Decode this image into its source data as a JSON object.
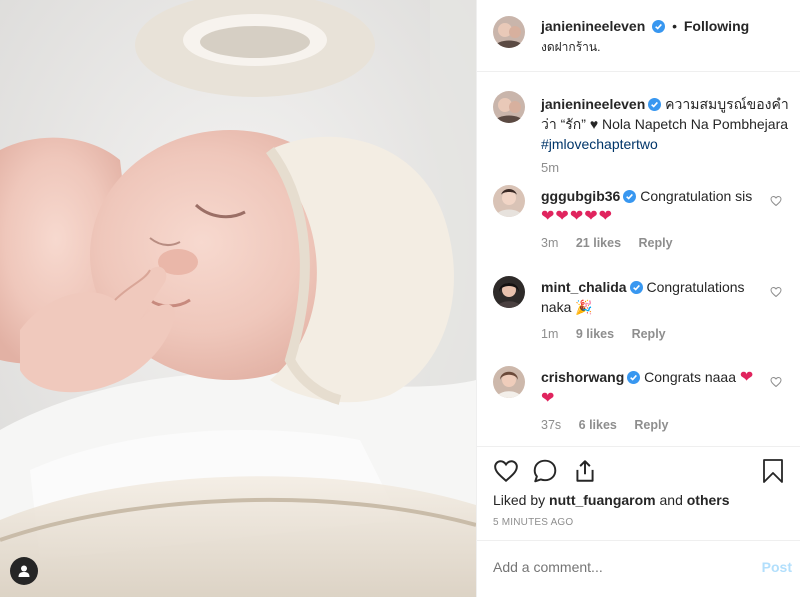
{
  "header": {
    "username": "janienineeleven",
    "separator": "•",
    "follow_label": "Following",
    "location": "งดฝากร้าน."
  },
  "caption": {
    "username": "janienineeleven",
    "text": "ความสมบูรณ์ของคำว่า “รัก” ♥ Nola Napetch Na Pombhejara",
    "hashtag": "#jmlovechaptertwo",
    "time": "5m"
  },
  "comments": [
    {
      "username": "gggubgib36",
      "text": "Congratulation sis",
      "emoji": "❤❤❤❤❤",
      "time": "3m",
      "likes": "21 likes",
      "reply": "Reply"
    },
    {
      "username": "mint_chalida",
      "text": "Congratulations naka",
      "emoji": "🎉",
      "time": "1m",
      "likes": "9 likes",
      "reply": "Reply"
    },
    {
      "username": "crishorwang",
      "text": "Congrats naaa",
      "emoji": "❤",
      "emoji2": "❤",
      "time": "37s",
      "likes": "6 likes",
      "reply": "Reply"
    }
  ],
  "liked_by": {
    "prefix": "Liked by",
    "user": "nutt_fuangarom",
    "and": "and",
    "others": "others"
  },
  "timestamp": "5 MINUTES AGO",
  "add_comment": {
    "placeholder": "Add a comment...",
    "post_label": "Post"
  },
  "icons": {
    "like": "heart-outline-icon",
    "comment": "speech-bubble-icon",
    "share": "share-icon",
    "save": "bookmark-icon",
    "verified": "verified-badge-icon",
    "tag": "person-tag-icon"
  },
  "colors": {
    "verified": "#3897f0",
    "link": "#003569",
    "heart": "#ed4956",
    "post_disabled": "#b2dffc"
  }
}
